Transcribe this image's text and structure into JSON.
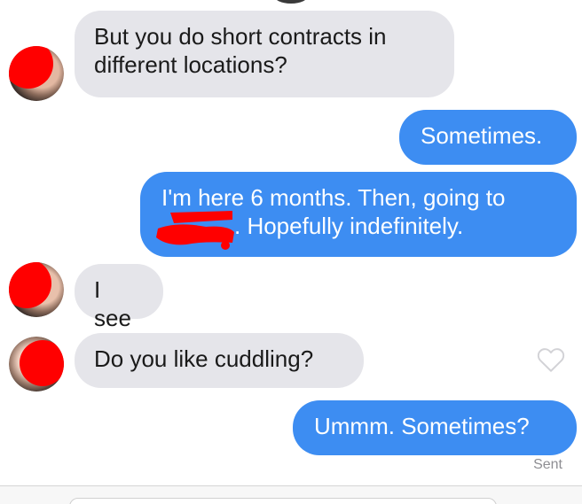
{
  "conversation": {
    "messages": [
      {
        "direction": "incoming",
        "text_lines": [
          "But you do short contracts in",
          "different locations?"
        ]
      },
      {
        "direction": "outgoing",
        "text": "Sometimes."
      },
      {
        "direction": "outgoing",
        "text_lines": [
          "I'm here 6 months. Then, going to",
          ". Hopefully indefinitely."
        ]
      },
      {
        "direction": "incoming",
        "text": "I see"
      },
      {
        "direction": "incoming",
        "text": "Do you like cuddling?"
      },
      {
        "direction": "outgoing",
        "text": "Ummm. Sometimes?"
      }
    ],
    "status": "Sent"
  },
  "colors": {
    "incoming_bubble": "#e5e5ea",
    "outgoing_bubble": "#3d8df2",
    "redaction": "#ff0000"
  },
  "icons": {
    "like": "heart-outline-icon"
  }
}
